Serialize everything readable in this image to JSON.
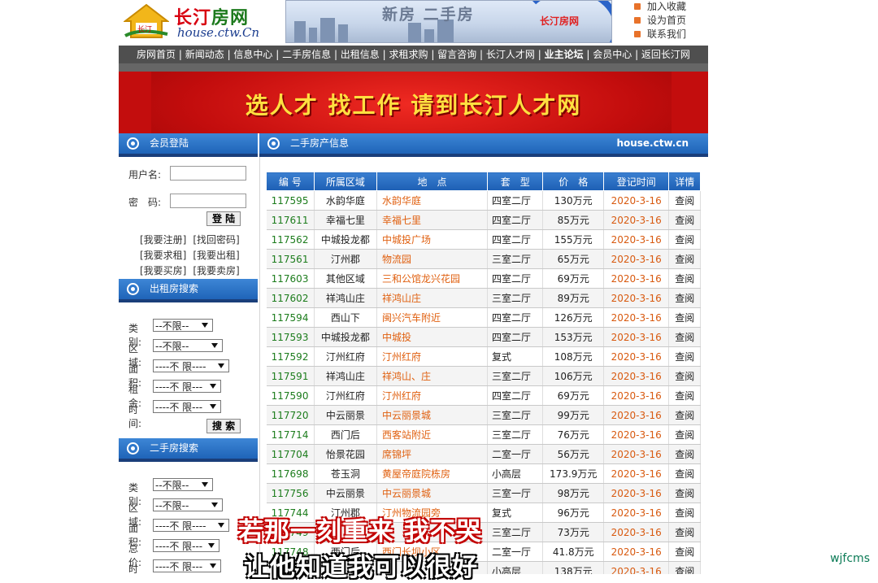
{
  "logo": {
    "cn_a": "长汀",
    "cn_b": "房网",
    "en": "house.ctw.Cn",
    "badge": "长汀"
  },
  "top_banner": {
    "title": "新房  二手房",
    "brand": "长汀房网"
  },
  "quick_links": [
    "加入收藏",
    "设为首页",
    "联系我们"
  ],
  "nav": [
    "房网首页",
    "新闻动态",
    "信息中心",
    "二手房信息",
    "出租信息",
    "求租求购",
    "留言咨询",
    "长汀人才网",
    "业主论坛",
    "会员中心",
    "返回长汀网"
  ],
  "ad_banner": "选人才  找工作  请到长汀人才网",
  "login": {
    "title": "会员登陆",
    "user_label": "用户名:",
    "pass_label": "密　码:",
    "submit": "登 陆",
    "links": [
      "[我要注册]",
      "[找回密码]",
      "[我要求租]",
      "[我要出租]",
      "[我要买房]",
      "[我要卖房]"
    ]
  },
  "rent_search": {
    "title": "出租房搜索",
    "fields": [
      {
        "label": "类别:",
        "value": "--不限--"
      },
      {
        "label": "区域:",
        "value": "--不限--"
      },
      {
        "label": "面积:",
        "value": "----不 限----"
      },
      {
        "label": "租金:",
        "value": "----不 限---"
      },
      {
        "label": "时间:",
        "value": "----不 限---"
      }
    ],
    "submit": "搜 索"
  },
  "sale_search": {
    "title": "二手房搜索",
    "fields": [
      {
        "label": "类别:",
        "value": "--不限--"
      },
      {
        "label": "区域:",
        "value": "--不限--"
      },
      {
        "label": "面积:",
        "value": "----不 限----"
      },
      {
        "label": "总价:",
        "value": "----不 限---"
      },
      {
        "label": "时间:",
        "value": "----不 限---"
      }
    ]
  },
  "listing": {
    "title": "二手房产信息",
    "site": "house.ctw.cn",
    "columns": [
      "编 号",
      "所属区域",
      "地　点",
      "套　型",
      "价　格",
      "登记时间",
      "详情"
    ],
    "rows": [
      [
        "117595",
        "水韵华庭",
        "水韵华庭",
        "四室二厅",
        "130万元",
        "2020-3-16",
        "查阅"
      ],
      [
        "117611",
        "幸福七里",
        "幸福七里",
        "四室二厅",
        "85万元",
        "2020-3-16",
        "查阅"
      ],
      [
        "117562",
        "中城投龙都",
        "中城投广场",
        "四室二厅",
        "155万元",
        "2020-3-16",
        "查阅"
      ],
      [
        "117561",
        "汀州郡",
        "物流园",
        "三室二厅",
        "65万元",
        "2020-3-16",
        "查阅"
      ],
      [
        "117603",
        "其他区域",
        "三和公馆龙兴花园",
        "四室二厅",
        "69万元",
        "2020-3-16",
        "查阅"
      ],
      [
        "117602",
        "祥鸿山庄",
        "祥鸿山庄",
        "三室二厅",
        "89万元",
        "2020-3-16",
        "查阅"
      ],
      [
        "117594",
        "西山下",
        "闽兴汽车附近",
        "四室二厅",
        "126万元",
        "2020-3-16",
        "查阅"
      ],
      [
        "117593",
        "中城投龙都",
        "中城投",
        "四室二厅",
        "153万元",
        "2020-3-16",
        "查阅"
      ],
      [
        "117592",
        "汀州红府",
        "汀州红府",
        "复式",
        "108万元",
        "2020-3-16",
        "查阅"
      ],
      [
        "117591",
        "祥鸿山庄",
        "祥鸿山、庄",
        "三室二厅",
        "106万元",
        "2020-3-16",
        "查阅"
      ],
      [
        "117590",
        "汀州红府",
        "汀州红府",
        "四室二厅",
        "69万元",
        "2020-3-16",
        "查阅"
      ],
      [
        "117720",
        "中云丽景",
        "中云丽景城",
        "三室二厅",
        "99万元",
        "2020-3-16",
        "查阅"
      ],
      [
        "117714",
        "西门后",
        "西客站附近",
        "三室二厅",
        "76万元",
        "2020-3-16",
        "查阅"
      ],
      [
        "117704",
        "怡景花园",
        "席锦坪",
        "二室一厅",
        "56万元",
        "2020-3-16",
        "查阅"
      ],
      [
        "117698",
        "苍玉洞",
        "黄屋帝庭院栋房",
        "小高层",
        "173.9万元",
        "2020-3-16",
        "查阅"
      ],
      [
        "117756",
        "中云丽景",
        "中云丽景城",
        "三室一厅",
        "98万元",
        "2020-3-16",
        "查阅"
      ],
      [
        "117744",
        "汀州郡",
        "汀州物流园旁",
        "复式",
        "96万元",
        "2020-3-16",
        "查阅"
      ],
      [
        "117749",
        "",
        "",
        "三室二厅",
        "73万元",
        "2020-3-16",
        "查阅"
      ],
      [
        "117748",
        "西门后",
        "西门长坝小区",
        "二室一厅",
        "41.8万元",
        "2020-3-16",
        "查阅"
      ],
      [
        "",
        "",
        "",
        "小高层",
        "138万元",
        "2020-3-16",
        "查阅"
      ]
    ]
  },
  "overlay_subtitles": [
    "若那一刻重来 我不哭",
    "让他知道我可以很好"
  ],
  "watermark": "wjfcms",
  "colors": {
    "nav_bg": "#4f4f4f",
    "header_blue": "#1f64b8",
    "ad_red": "#c30d0d",
    "id_green": "#1c7c1c",
    "link_orange": "#e06010"
  }
}
